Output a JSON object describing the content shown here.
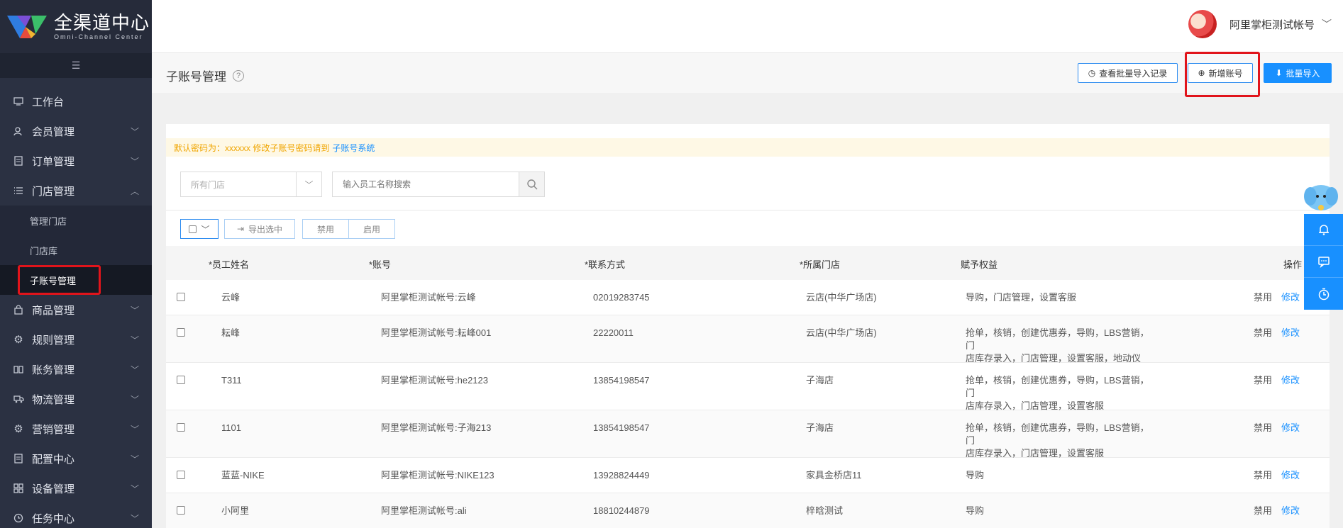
{
  "brand": {
    "title": "全渠道中心",
    "subtitle": "Omni-Channel Center"
  },
  "sidebar": {
    "items": [
      {
        "label": "工作台",
        "icon": "monitor-icon",
        "expandable": false
      },
      {
        "label": "会员管理",
        "icon": "users-icon",
        "expandable": true
      },
      {
        "label": "订单管理",
        "icon": "order-icon",
        "expandable": true
      },
      {
        "label": "门店管理",
        "icon": "list-icon",
        "expandable": true,
        "expanded": true,
        "children": [
          {
            "label": "管理门店"
          },
          {
            "label": "门店库"
          },
          {
            "label": "子账号管理",
            "active": true
          }
        ]
      },
      {
        "label": "商品管理",
        "icon": "bag-icon",
        "expandable": true
      },
      {
        "label": "规则管理",
        "icon": "gear-icon",
        "expandable": true
      },
      {
        "label": "账务管理",
        "icon": "book-icon",
        "expandable": true
      },
      {
        "label": "物流管理",
        "icon": "truck-icon",
        "expandable": true
      },
      {
        "label": "营销管理",
        "icon": "gear-icon",
        "expandable": true
      },
      {
        "label": "配置中心",
        "icon": "document-icon",
        "expandable": true
      },
      {
        "label": "设备管理",
        "icon": "grid-icon",
        "expandable": true
      },
      {
        "label": "任务中心",
        "icon": "clock-icon",
        "expandable": true
      }
    ]
  },
  "header": {
    "user_name": "阿里掌柜测试帐号"
  },
  "page": {
    "title": "子账号管理",
    "help": "?",
    "btn_history": "查看批量导入记录",
    "btn_add": "新增账号",
    "btn_import": "批量导入"
  },
  "notice": {
    "text": "默认密码为：xxxxxx 修改子账号密码请到",
    "link": "子账号系统"
  },
  "filters": {
    "store_placeholder": "所有门店",
    "search_placeholder": "输入员工名称搜索"
  },
  "toolbar": {
    "export": "导出选中",
    "disable": "禁用",
    "enable": "启用"
  },
  "table": {
    "headers": {
      "name": "*员工姓名",
      "account": "*账号",
      "contact": "*联系方式",
      "store": "*所属门店",
      "rights": "赋予权益",
      "ops": "操作"
    },
    "rows": [
      {
        "name": "云峰",
        "account": "阿里掌柜测试帐号:云峰",
        "contact": "02019283745",
        "store": "云店(中华广场店)",
        "rights": [
          "导购，门店管理，设置客服"
        ],
        "disable": "禁用",
        "edit": "修改"
      },
      {
        "name": "耘峰",
        "account": "阿里掌柜测试帐号:耘峰001",
        "contact": "22220011",
        "store": "云店(中华广场店)",
        "rights": [
          "抢单，核销，创建优惠券，导购，LBS营销，门",
          "店库存录入，门店管理，设置客服，地动仪"
        ],
        "disable": "禁用",
        "edit": "修改"
      },
      {
        "name": "T311",
        "account": "阿里掌柜测试帐号:he2123",
        "contact": "13854198547",
        "store": "子海店",
        "rights": [
          "抢单，核销，创建优惠券，导购，LBS营销，门",
          "店库存录入，门店管理，设置客服"
        ],
        "disable": "禁用",
        "edit": "修改"
      },
      {
        "name": "1101",
        "account": "阿里掌柜测试帐号:子海213",
        "contact": "13854198547",
        "store": "子海店",
        "rights": [
          "抢单，核销，创建优惠券，导购，LBS营销，门",
          "店库存录入，门店管理，设置客服"
        ],
        "disable": "禁用",
        "edit": "修改"
      },
      {
        "name": "蓝蓝-NIKE",
        "account": "阿里掌柜测试帐号:NIKE123",
        "contact": "13928824449",
        "store": "家具金桥店11",
        "rights": [
          "导购"
        ],
        "disable": "禁用",
        "edit": "修改"
      },
      {
        "name": "小阿里",
        "account": "阿里掌柜测试帐号:ali",
        "contact": "18810244879",
        "store": "梓晗测试",
        "rights": [
          "导购"
        ],
        "disable": "禁用",
        "edit": "修改"
      }
    ]
  },
  "colors": {
    "sidebar_bg": "#2b3142",
    "primary": "#1890ff",
    "highlight": "#e1141b",
    "notice_text": "#f0a500"
  }
}
